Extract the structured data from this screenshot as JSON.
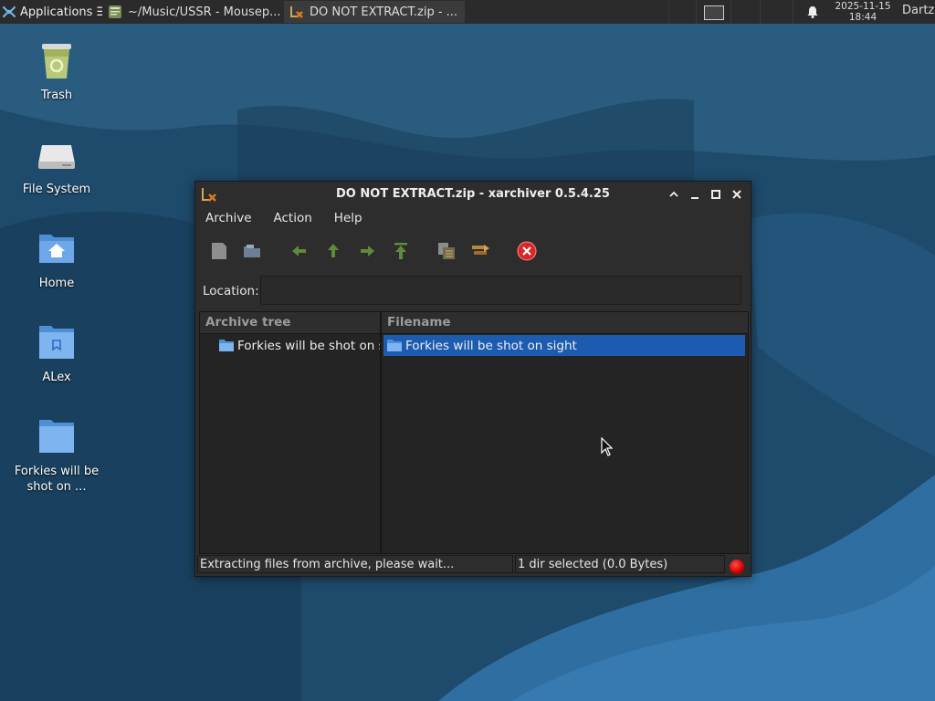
{
  "panel": {
    "applications_label": "Applications ☰",
    "tasks": [
      {
        "label": "~/Music/USSR - Mousep...",
        "icon": "text-editor-icon",
        "active": false
      },
      {
        "label": "DO NOT EXTRACT.zip - ...",
        "icon": "xarchiver-icon",
        "active": true
      }
    ],
    "clock_date": "2025-11-15",
    "clock_time": "18:44",
    "user": "Dartz"
  },
  "desktop": {
    "icons": [
      {
        "label": "Trash",
        "icon": "trash-icon"
      },
      {
        "label": "File System",
        "icon": "drive-icon"
      },
      {
        "label": "Home",
        "icon": "home-folder-icon"
      },
      {
        "label": "ALex",
        "icon": "folder-icon"
      },
      {
        "label": "Forkies will be shot on ...",
        "icon": "folder-icon"
      }
    ]
  },
  "window": {
    "title": "DO NOT EXTRACT.zip - xarchiver 0.5.4.25",
    "menu": [
      "Archive",
      "Action",
      "Help"
    ],
    "toolbar": [
      "new-archive-icon",
      "open-archive-icon",
      "back-icon",
      "up-icon",
      "forward-icon",
      "home-icon",
      "extract-icon",
      "convert-icon",
      "stop-icon"
    ],
    "location_label": "Location:",
    "location_value": "",
    "archive_tree_header": "Archive tree",
    "filename_header": "Filename",
    "tree_items": [
      "Forkies will be shot on sight"
    ],
    "files": [
      {
        "name": "Forkies will be shot on sight",
        "selected": true
      }
    ],
    "status_left": "Extracting files from archive, please wait...",
    "status_right": "1 dir selected (0.0 Bytes)"
  },
  "colors": {
    "panel_bg": "#2b2b2b",
    "window_bg": "#2d2d2d",
    "selection": "#1c5cb0",
    "wallpaper": "#1d4a6a"
  }
}
